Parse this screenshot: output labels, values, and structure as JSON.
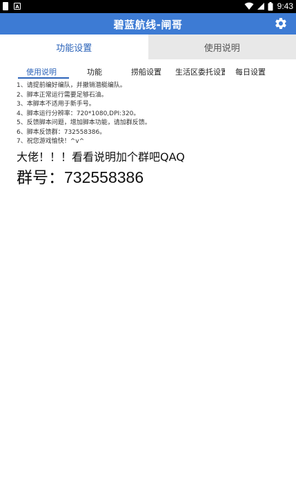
{
  "status_bar": {
    "time": "9:43",
    "icons": [
      "document-icon",
      "a-icon",
      "wifi-icon",
      "signal-icon",
      "battery-icon"
    ]
  },
  "title_bar": {
    "title": "碧蓝航线-闸哥",
    "settings_icon": "gear-icon"
  },
  "primary_tabs": [
    {
      "label": "功能设置",
      "selected": true
    },
    {
      "label": "使用说明",
      "selected": false
    }
  ],
  "sub_tabs": [
    {
      "label": "使用说明",
      "selected": true
    },
    {
      "label": "功能",
      "selected": false
    },
    {
      "label": "捞船设置",
      "selected": false
    },
    {
      "label": "生活区委托设置",
      "selected": false
    },
    {
      "label": "每日设置",
      "selected": false
    }
  ],
  "instructions": [
    "1、请提前编好编队，并撤销潜艇编队。",
    "2、脚本正常运行需要足够石油。",
    "3、本脚本不适用于新手号。",
    "4、脚本运行分辨率：720*1080,DPI:320。",
    "5、反馈脚本问题，增加脚本功能，请加群反馈。",
    "6、脚本反馈群：732558386。",
    "7、祝您游戏愉快！^v^"
  ],
  "headline": "大佬！！！看看说明加个群吧QAQ",
  "group_label": "群号：",
  "group_number": "732558386",
  "colors": {
    "title_bar": "#3d7bd4",
    "accent": "#2b63b9",
    "inactive_tab": "#e8e8e8"
  }
}
